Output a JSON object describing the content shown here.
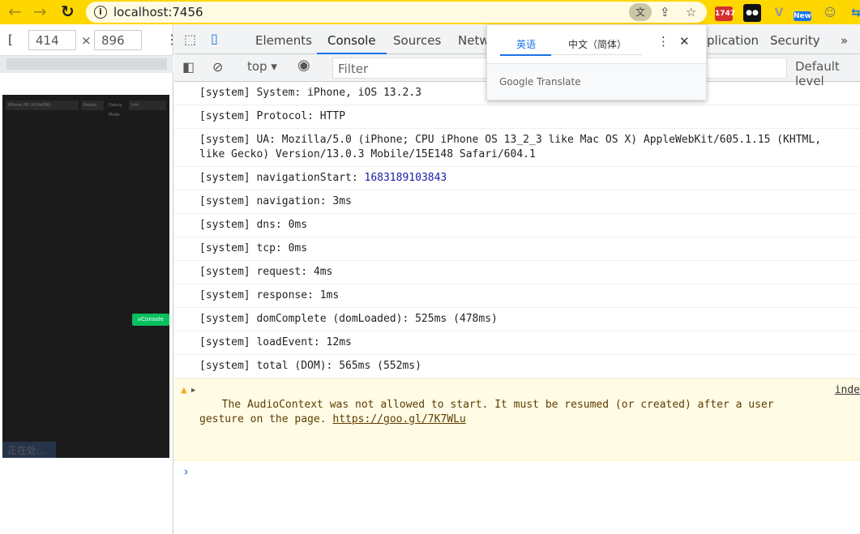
{
  "browser": {
    "url": "localhost:7456",
    "back": "←",
    "forward": "→",
    "reload": "↻",
    "ext_badges": [
      "1747",
      "New"
    ]
  },
  "device": {
    "bracket": "[",
    "width": "414",
    "times": "×",
    "height": "896",
    "more": "⋮",
    "phone": {
      "device_select": "iPhone XR (414x896)",
      "rotate": "Rotate",
      "debug": "Debug Mode",
      "info": "Info",
      "vconsole": "vConsole",
      "toast": "正在处..."
    }
  },
  "devtools": {
    "tabs": [
      "Elements",
      "Console",
      "Sources",
      "Netw",
      "plication",
      "Security"
    ],
    "active_tab": "Console",
    "more_tabs": "»",
    "context": "top",
    "filter_placeholder": "Filter",
    "levels": "Default level"
  },
  "logs": [
    {
      "prefix": "[system] System: ",
      "text": "iPhone, iOS 13.2.3"
    },
    {
      "prefix": "[system] Protocol: ",
      "text": "HTTP"
    },
    {
      "prefix": "[system] UA: ",
      "text": "Mozilla/5.0 (iPhone; CPU iPhone OS 13_2_3 like Mac OS X) AppleWebKit/605.1.15 (KHTML,\nlike Gecko) Version/13.0.3 Mobile/15E148 Safari/604.1"
    },
    {
      "prefix": "[system] navigationStart: ",
      "num": "1683189103843"
    },
    {
      "prefix": "[system] navigation: ",
      "text": "3ms"
    },
    {
      "prefix": "[system] dns: ",
      "text": "0ms"
    },
    {
      "prefix": "[system] tcp: ",
      "text": "0ms"
    },
    {
      "prefix": "[system] request: ",
      "text": "4ms"
    },
    {
      "prefix": "[system] response: ",
      "text": "1ms"
    },
    {
      "prefix": "[system] domComplete (domLoaded): ",
      "text": "525ms (478ms)"
    },
    {
      "prefix": "[system] loadEvent: ",
      "text": "12ms"
    },
    {
      "prefix": "[system] total (DOM): ",
      "text": "565ms (552ms)"
    }
  ],
  "warning": {
    "text": "The AudioContext was not allowed to start. It must be resumed (or created) after a user\ngesture on the page. ",
    "link": "https://goo.gl/7K7WLu",
    "source": "inde"
  },
  "prompt": "›",
  "translate": {
    "lang1": "英语",
    "lang2": "中文（简体）",
    "brand": "Google Translate"
  }
}
